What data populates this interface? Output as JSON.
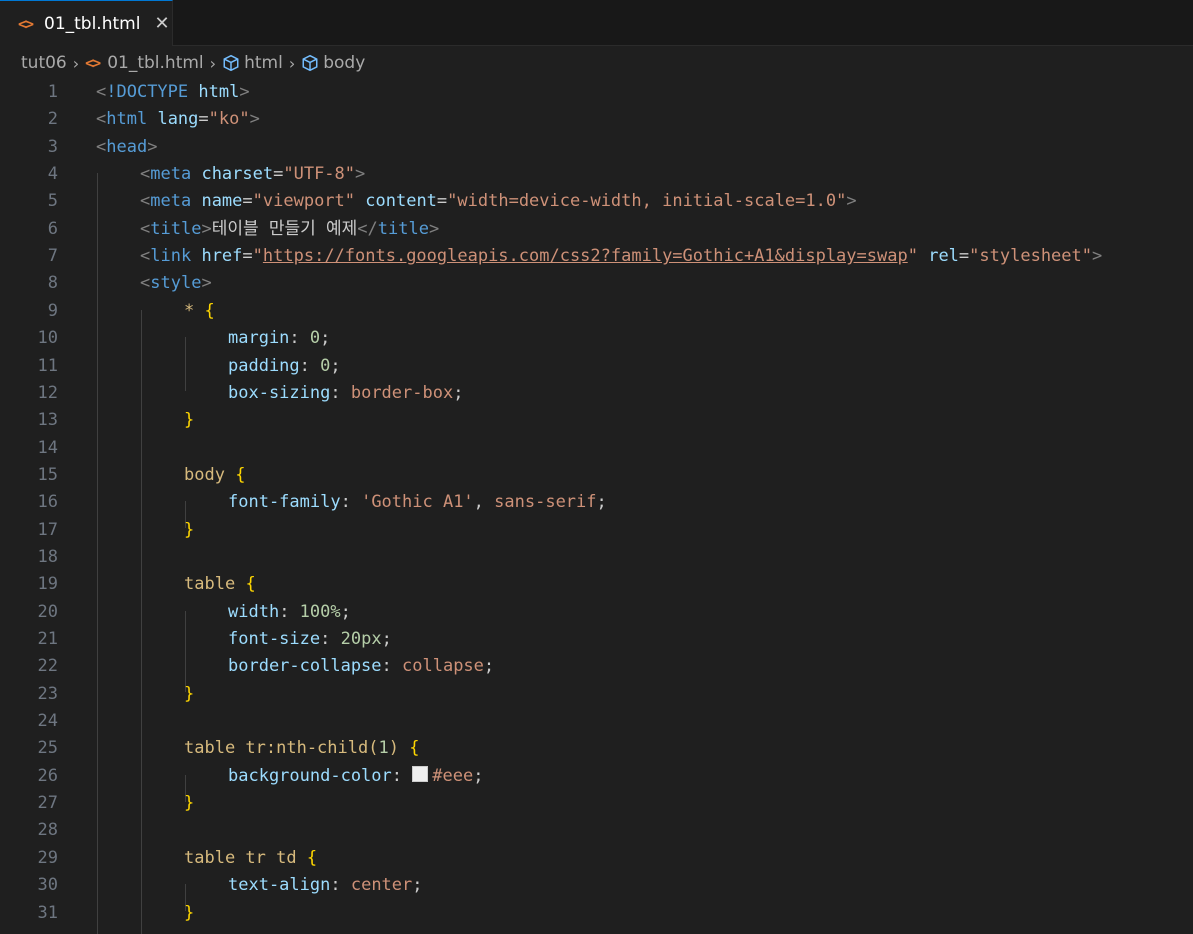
{
  "tab": {
    "icon": "html-file-icon",
    "filename": "01_tbl.html",
    "close": "✕"
  },
  "breadcrumb": {
    "folder": "tut06",
    "file": "01_tbl.html",
    "node1": "html",
    "node2": "body"
  },
  "colors": {
    "tag": "#569cd6",
    "attribute": "#9cdcfe",
    "string": "#ce9178",
    "selector": "#d7ba7d",
    "brace": "#ffd700",
    "number": "#b5cea8",
    "swatch": "#eeeeee"
  },
  "lines": [
    {
      "n": "1",
      "indent": 0,
      "tokens": [
        [
          "tag-br",
          "<"
        ],
        [
          "tag",
          "!DOCTYPE"
        ],
        [
          "txt",
          " "
        ],
        [
          "attr",
          "html"
        ],
        [
          "tag-br",
          ">"
        ]
      ]
    },
    {
      "n": "2",
      "indent": 0,
      "tokens": [
        [
          "tag-br",
          "<"
        ],
        [
          "tag",
          "html"
        ],
        [
          "txt",
          " "
        ],
        [
          "attr",
          "lang"
        ],
        [
          "txt",
          "="
        ],
        [
          "str",
          "\"ko\""
        ],
        [
          "tag-br",
          ">"
        ]
      ]
    },
    {
      "n": "3",
      "indent": 0,
      "tokens": [
        [
          "tag-br",
          "<"
        ],
        [
          "tag",
          "head"
        ],
        [
          "tag-br",
          ">"
        ]
      ]
    },
    {
      "n": "4",
      "indent": 1,
      "tokens": [
        [
          "tag-br",
          "<"
        ],
        [
          "tag",
          "meta"
        ],
        [
          "txt",
          " "
        ],
        [
          "attr",
          "charset"
        ],
        [
          "txt",
          "="
        ],
        [
          "str",
          "\"UTF-8\""
        ],
        [
          "tag-br",
          ">"
        ]
      ]
    },
    {
      "n": "5",
      "indent": 1,
      "tokens": [
        [
          "tag-br",
          "<"
        ],
        [
          "tag",
          "meta"
        ],
        [
          "txt",
          " "
        ],
        [
          "attr",
          "name"
        ],
        [
          "txt",
          "="
        ],
        [
          "str",
          "\"viewport\""
        ],
        [
          "txt",
          " "
        ],
        [
          "attr",
          "content"
        ],
        [
          "txt",
          "="
        ],
        [
          "str",
          "\"width=device-width, initial-scale=1.0\""
        ],
        [
          "tag-br",
          ">"
        ]
      ]
    },
    {
      "n": "6",
      "indent": 1,
      "tokens": [
        [
          "tag-br",
          "<"
        ],
        [
          "tag",
          "title"
        ],
        [
          "tag-br",
          ">"
        ],
        [
          "txt",
          "테이블 만들기 예제"
        ],
        [
          "tag-br",
          "</"
        ],
        [
          "tag",
          "title"
        ],
        [
          "tag-br",
          ">"
        ]
      ]
    },
    {
      "n": "7",
      "indent": 1,
      "tokens": [
        [
          "tag-br",
          "<"
        ],
        [
          "tag",
          "link"
        ],
        [
          "txt",
          " "
        ],
        [
          "attr",
          "href"
        ],
        [
          "txt",
          "="
        ],
        [
          "str",
          "\""
        ],
        [
          "link",
          "https://fonts.googleapis.com/css2?family=Gothic+A1&display=swap"
        ],
        [
          "str",
          "\""
        ],
        [
          "txt",
          " "
        ],
        [
          "attr",
          "rel"
        ],
        [
          "txt",
          "="
        ],
        [
          "str",
          "\"stylesheet\""
        ],
        [
          "tag-br",
          ">"
        ]
      ]
    },
    {
      "n": "8",
      "indent": 1,
      "tokens": [
        [
          "tag-br",
          "<"
        ],
        [
          "tag",
          "style"
        ],
        [
          "tag-br",
          ">"
        ]
      ]
    },
    {
      "n": "9",
      "indent": 2,
      "tokens": [
        [
          "sel",
          "*"
        ],
        [
          "txt",
          " "
        ],
        [
          "brace",
          "{"
        ]
      ]
    },
    {
      "n": "10",
      "indent": 3,
      "tokens": [
        [
          "prop",
          "margin"
        ],
        [
          "punc",
          ": "
        ],
        [
          "num",
          "0"
        ],
        [
          "punc",
          ";"
        ]
      ]
    },
    {
      "n": "11",
      "indent": 3,
      "tokens": [
        [
          "prop",
          "padding"
        ],
        [
          "punc",
          ": "
        ],
        [
          "num",
          "0"
        ],
        [
          "punc",
          ";"
        ]
      ]
    },
    {
      "n": "12",
      "indent": 3,
      "tokens": [
        [
          "prop",
          "box-sizing"
        ],
        [
          "punc",
          ": "
        ],
        [
          "val",
          "border-box"
        ],
        [
          "punc",
          ";"
        ]
      ]
    },
    {
      "n": "13",
      "indent": 2,
      "tokens": [
        [
          "brace",
          "}"
        ]
      ]
    },
    {
      "n": "14",
      "indent": 2,
      "tokens": []
    },
    {
      "n": "15",
      "indent": 2,
      "tokens": [
        [
          "sel",
          "body"
        ],
        [
          "txt",
          " "
        ],
        [
          "brace",
          "{"
        ]
      ]
    },
    {
      "n": "16",
      "indent": 3,
      "tokens": [
        [
          "prop",
          "font-family"
        ],
        [
          "punc",
          ": "
        ],
        [
          "val",
          "'Gothic A1'"
        ],
        [
          "punc",
          ", "
        ],
        [
          "val",
          "sans-serif"
        ],
        [
          "punc",
          ";"
        ]
      ]
    },
    {
      "n": "17",
      "indent": 2,
      "tokens": [
        [
          "brace",
          "}"
        ]
      ]
    },
    {
      "n": "18",
      "indent": 2,
      "tokens": []
    },
    {
      "n": "19",
      "indent": 2,
      "tokens": [
        [
          "sel",
          "table"
        ],
        [
          "txt",
          " "
        ],
        [
          "brace",
          "{"
        ]
      ]
    },
    {
      "n": "20",
      "indent": 3,
      "tokens": [
        [
          "prop",
          "width"
        ],
        [
          "punc",
          ": "
        ],
        [
          "num",
          "100%"
        ],
        [
          "punc",
          ";"
        ]
      ]
    },
    {
      "n": "21",
      "indent": 3,
      "tokens": [
        [
          "prop",
          "font-size"
        ],
        [
          "punc",
          ": "
        ],
        [
          "num",
          "20px"
        ],
        [
          "punc",
          ";"
        ]
      ]
    },
    {
      "n": "22",
      "indent": 3,
      "tokens": [
        [
          "prop",
          "border-collapse"
        ],
        [
          "punc",
          ": "
        ],
        [
          "val",
          "collapse"
        ],
        [
          "punc",
          ";"
        ]
      ]
    },
    {
      "n": "23",
      "indent": 2,
      "tokens": [
        [
          "brace",
          "}"
        ]
      ]
    },
    {
      "n": "24",
      "indent": 2,
      "tokens": []
    },
    {
      "n": "25",
      "indent": 2,
      "tokens": [
        [
          "sel",
          "table tr:nth-child("
        ],
        [
          "num",
          "1"
        ],
        [
          "sel",
          ")"
        ],
        [
          "txt",
          " "
        ],
        [
          "brace",
          "{"
        ]
      ]
    },
    {
      "n": "26",
      "indent": 3,
      "tokens": [
        [
          "prop",
          "background-color"
        ],
        [
          "punc",
          ": "
        ],
        [
          "swatch",
          ""
        ],
        [
          "val",
          "#eee"
        ],
        [
          "punc",
          ";"
        ]
      ]
    },
    {
      "n": "27",
      "indent": 2,
      "tokens": [
        [
          "brace",
          "}"
        ]
      ]
    },
    {
      "n": "28",
      "indent": 2,
      "tokens": []
    },
    {
      "n": "29",
      "indent": 2,
      "tokens": [
        [
          "sel",
          "table tr td"
        ],
        [
          "txt",
          " "
        ],
        [
          "brace",
          "{"
        ]
      ]
    },
    {
      "n": "30",
      "indent": 3,
      "tokens": [
        [
          "prop",
          "text-align"
        ],
        [
          "punc",
          ": "
        ],
        [
          "val",
          "center"
        ],
        [
          "punc",
          ";"
        ]
      ]
    },
    {
      "n": "31",
      "indent": 2,
      "tokens": [
        [
          "brace",
          "}"
        ]
      ]
    }
  ]
}
